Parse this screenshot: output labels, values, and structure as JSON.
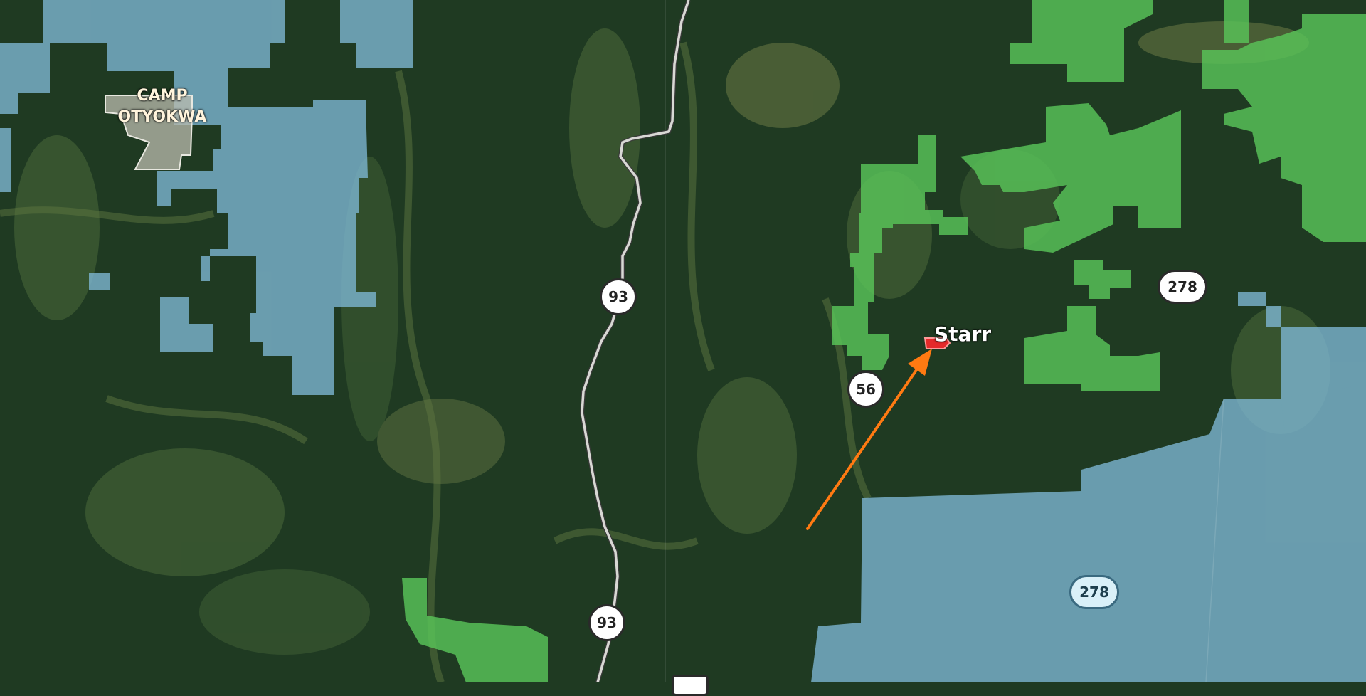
{
  "map": {
    "basemap": "satellite",
    "colors": {
      "forest_dark": "#1f3a22",
      "forest_mid": "#2e5232",
      "clearing": "#6b7a45",
      "public_land_blue": "#7fb9d6",
      "private_land_green": "#59c459",
      "road": "#d8d8d4",
      "marker_red": "#e52a2a",
      "arrow_orange": "#ff7a12"
    },
    "labels": {
      "camp": "CAMP\nOTYOKWA",
      "town": "Starr"
    },
    "route_shields": [
      {
        "id": "hwy93-north",
        "number": "93",
        "shape": "round"
      },
      {
        "id": "hwy93-south",
        "number": "93",
        "shape": "round"
      },
      {
        "id": "hwy56",
        "number": "56",
        "shape": "round"
      },
      {
        "id": "hwy278-north",
        "number": "278",
        "shape": "oval"
      },
      {
        "id": "hwy278-south",
        "number": "278",
        "shape": "oval"
      }
    ]
  }
}
